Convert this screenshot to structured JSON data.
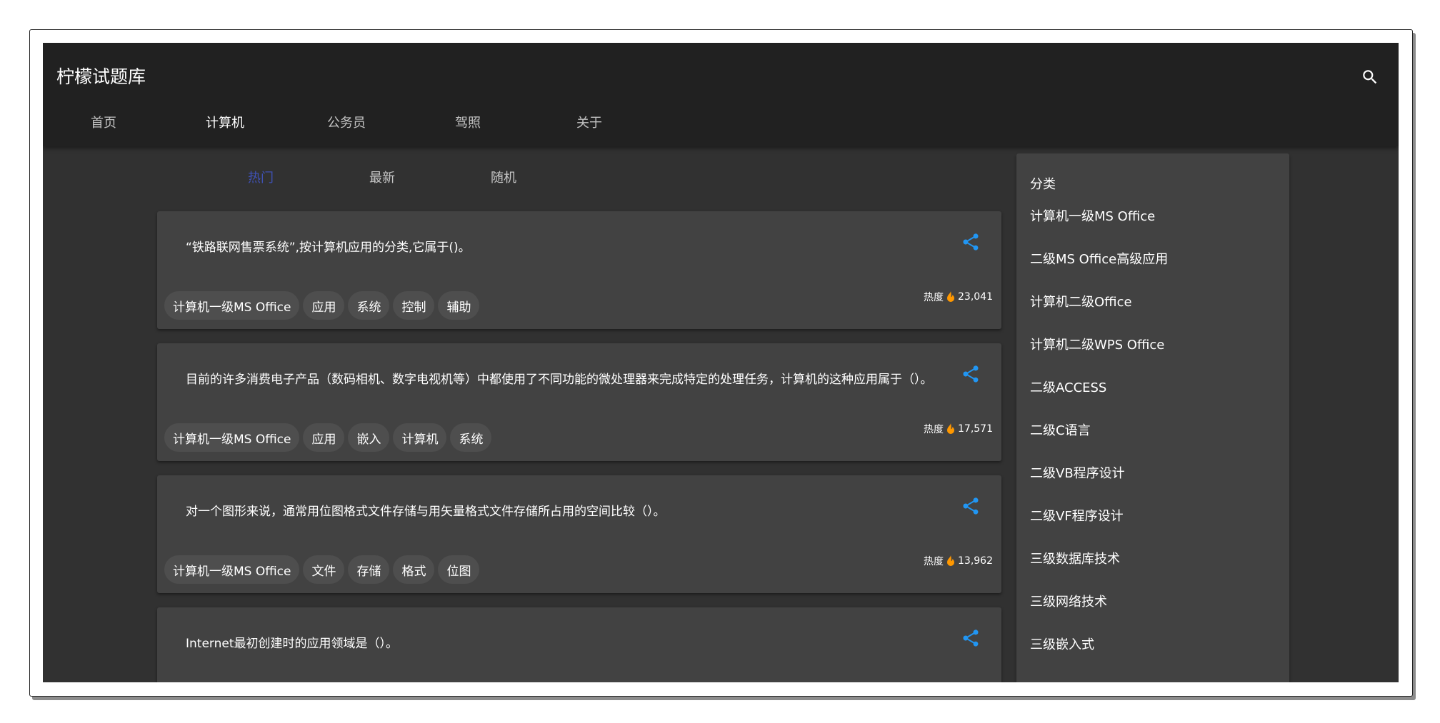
{
  "app": {
    "title": "柠檬试题库"
  },
  "header": {
    "search_icon": "search-icon",
    "main_tabs": [
      {
        "label": "首页",
        "active": false
      },
      {
        "label": "计算机",
        "active": true
      },
      {
        "label": "公务员",
        "active": false
      },
      {
        "label": "驾照",
        "active": false
      },
      {
        "label": "关于",
        "active": false
      }
    ]
  },
  "sub_tabs": [
    {
      "label": "热门",
      "active": true
    },
    {
      "label": "最新",
      "active": false
    },
    {
      "label": "随机",
      "active": false
    }
  ],
  "heat_label": "热度",
  "questions": [
    {
      "text": "“铁路联网售票系统”,按计算机应用的分类,它属于()。",
      "tags": [
        "计算机一级MS Office",
        "应用",
        "系统",
        "控制",
        "辅助"
      ],
      "heat": "23,041"
    },
    {
      "text": "目前的许多消费电子产品（数码相机、数字电视机等）中都使用了不同功能的微处理器来完成特定的处理任务，计算机的这种应用属于（）。",
      "tags": [
        "计算机一级MS Office",
        "应用",
        "嵌入",
        "计算机",
        "系统"
      ],
      "heat": "17,571"
    },
    {
      "text": "对一个图形来说，通常用位图格式文件存储与用矢量格式文件存储所占用的空间比较（）。",
      "tags": [
        "计算机一级MS Office",
        "文件",
        "存储",
        "格式",
        "位图"
      ],
      "heat": "13,962"
    },
    {
      "text": "Internet最初创建时的应用领域是（）。",
      "tags": [],
      "heat": ""
    }
  ],
  "sidebar": {
    "title": "分类",
    "items": [
      "计算机一级MS Office",
      "二级MS Office高级应用",
      "计算机二级Office",
      "计算机二级WPS Office",
      "二级ACCESS",
      "二级C语言",
      "二级VB程序设计",
      "二级VF程序设计",
      "三级数据库技术",
      "三级网络技术",
      "三级嵌入式"
    ]
  },
  "colors": {
    "appbar": "#212121",
    "background": "#313131",
    "card": "#424242",
    "active_subtab": "#3f51b5",
    "share_icon": "#2196f3",
    "fire_icon": "#ff9800"
  }
}
